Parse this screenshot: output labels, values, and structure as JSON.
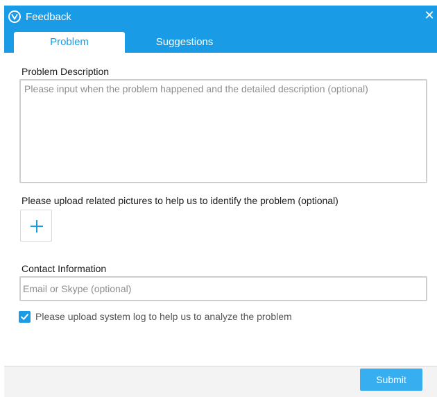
{
  "window": {
    "title": "Feedback",
    "logo_icon": "v-logo-icon",
    "close_icon": "close-icon",
    "close_glyph": "✕"
  },
  "tabs": [
    {
      "label": "Problem",
      "active": true
    },
    {
      "label": "Suggestions",
      "active": false
    }
  ],
  "problem_description": {
    "label": "Problem Description",
    "value": "",
    "placeholder": "Please input when the problem happened and the detailed description (optional)"
  },
  "upload": {
    "label": "Please upload related pictures to help us to identify the problem (optional)",
    "add_icon": "plus-icon"
  },
  "contact": {
    "label": "Contact Information",
    "value": "",
    "placeholder": "Email or Skype (optional)"
  },
  "system_log": {
    "label": "Please upload system log to help us to analyze the problem",
    "checked": true
  },
  "footer": {
    "submit_label": "Submit"
  },
  "colors": {
    "accent": "#1a9be6",
    "submit": "#36aef0",
    "footer_bg": "#f3f3f3"
  }
}
